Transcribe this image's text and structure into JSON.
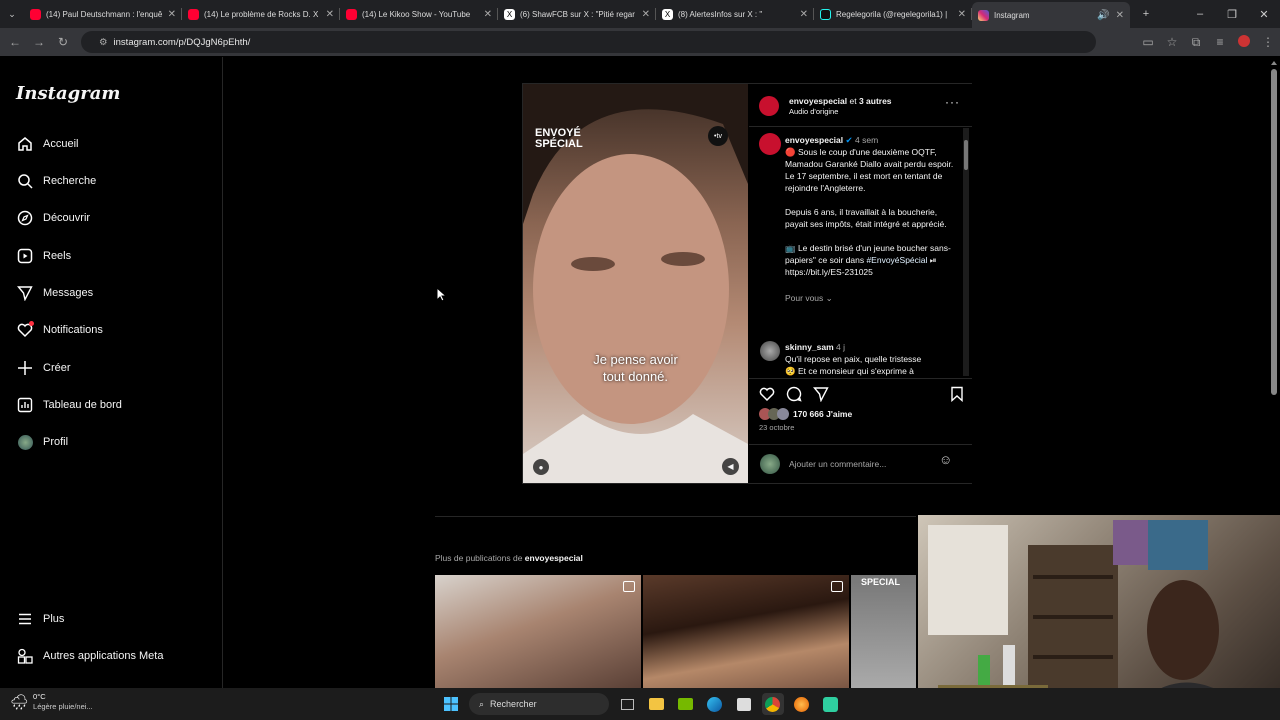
{
  "browser": {
    "tabs": [
      {
        "title": "(14) Paul Deutschmann : l'enquê",
        "color": "#ff0033"
      },
      {
        "title": "(14) Le problème de Rocks D. X",
        "color": "#ff0033"
      },
      {
        "title": "(14) Le Kikoo Show - YouTube",
        "color": "#ff0033"
      },
      {
        "title": "(6) ShawFCB sur X : \"Pitié regar",
        "color": "#ffffff"
      },
      {
        "title": "(8) AlertesInfos sur X : \"",
        "color": "#ffffff"
      },
      {
        "title": "Regelegorila (@regelegorila1) |",
        "color": "#ffffff"
      },
      {
        "title": "Instagram",
        "color": "#e1306c"
      }
    ],
    "url": "instagram.com/p/DQJgN6pEhth/"
  },
  "sidebar": {
    "logo": "Instagram",
    "items": [
      {
        "label": "Accueil",
        "icon": "home-icon"
      },
      {
        "label": "Recherche",
        "icon": "search-icon"
      },
      {
        "label": "Découvrir",
        "icon": "compass-icon"
      },
      {
        "label": "Reels",
        "icon": "reels-icon"
      },
      {
        "label": "Messages",
        "icon": "messages-icon"
      },
      {
        "label": "Notifications",
        "icon": "heart-icon"
      },
      {
        "label": "Créer",
        "icon": "plus-icon"
      },
      {
        "label": "Tableau de bord",
        "icon": "dashboard-icon"
      },
      {
        "label": "Profil",
        "icon": "avatar"
      }
    ],
    "bottom": [
      {
        "label": "Plus",
        "icon": "menu-icon"
      },
      {
        "label": "Autres applications Meta",
        "icon": "meta-apps-icon"
      }
    ]
  },
  "post": {
    "video": {
      "brand_line1": "ENVOYÉ",
      "brand_line2": "SPÉCIAL",
      "tv_badge": "•tv",
      "subtitle_line1": "Je pense avoir",
      "subtitle_line2": "tout donné."
    },
    "header": {
      "account": "envoyespecial",
      "and_others": " et ",
      "others": "3 autres",
      "audio": "Audio d'origine"
    },
    "caption": {
      "account": "envoyespecial",
      "time": "4 sem",
      "p1": "🔴 Sous le coup d'une deuxième OQTF, Mamadou Garanké Diallo avait perdu espoir. Le 17 septembre, il est mort en tentant de rejoindre l'Angleterre.",
      "p2": "Depuis 6 ans, il travaillait à la boucherie, payait ses impôts, était intégré et apprécié.",
      "p3a": "📺 Le destin brisé d'un jeune boucher sans-papiers\" ce soir dans ",
      "p3tag": "#EnvoyéSpécial",
      "p3b": " ⏯ https://bit.ly/ES-231025",
      "more": "Pour vous"
    },
    "comment": {
      "account": "skinny_sam",
      "time": "4 j",
      "text1": "Qu'il repose en paix, quelle tristesse",
      "text2": "🥺 Et ce monsieur qui s'exprime à"
    },
    "likes": "170 666 J'aime",
    "date": "23 octobre",
    "add_comment": "Ajouter un commentaire..."
  },
  "more_posts": {
    "prefix": "Plus de publications de ",
    "account": "envoyespecial",
    "thumb3_text": "SPECIAL"
  },
  "taskbar": {
    "weather_temp": "0°C",
    "weather_desc": "Légère pluie/nei...",
    "search": "Rechercher"
  }
}
